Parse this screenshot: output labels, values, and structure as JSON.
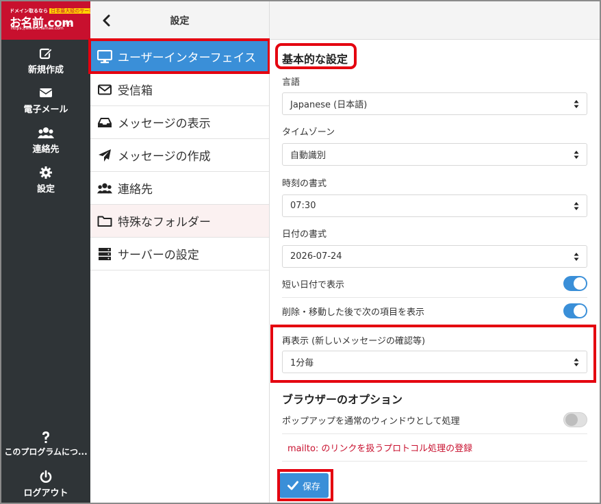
{
  "logo": {
    "tagline": "ドメイン取るなら",
    "badge": "日本最大級のサービス",
    "name": "お名前.com",
    "url": "https://www.onamae.com",
    "sub": "GMO"
  },
  "nav": {
    "items": [
      {
        "label": "新規作成",
        "icon": "compose-icon"
      },
      {
        "label": "電子メール",
        "icon": "envelope-icon"
      },
      {
        "label": "連絡先",
        "icon": "users-icon"
      },
      {
        "label": "設定",
        "icon": "gear-icon"
      }
    ],
    "about": {
      "label": "このプログラムにつ...",
      "icon": "question-icon"
    },
    "logout": {
      "label": "ログアウト",
      "icon": "power-icon"
    }
  },
  "settings": {
    "title": "設定",
    "items": [
      {
        "label": "ユーザーインターフェイス",
        "icon": "monitor-icon"
      },
      {
        "label": "受信箱",
        "icon": "envelope-outline-icon"
      },
      {
        "label": "メッセージの表示",
        "icon": "inbox-tray-icon"
      },
      {
        "label": "メッセージの作成",
        "icon": "paper-plane-icon"
      },
      {
        "label": "連絡先",
        "icon": "users-icon"
      },
      {
        "label": "特殊なフォルダー",
        "icon": "folder-icon"
      },
      {
        "label": "サーバーの設定",
        "icon": "server-icon"
      }
    ]
  },
  "main": {
    "section1_title": "基本的な設定",
    "language": {
      "label": "言語",
      "value": "Japanese (日本語)"
    },
    "timezone": {
      "label": "タイムゾーン",
      "value": "自動識別"
    },
    "time_format": {
      "label": "時刻の書式",
      "value": "07:30"
    },
    "date_format": {
      "label": "日付の書式",
      "value": "2026-07-24"
    },
    "short_date": {
      "label": "短い日付で表示",
      "enabled": true
    },
    "show_next": {
      "label": "削除・移動した後で次の項目を表示",
      "enabled": true
    },
    "refresh": {
      "label": "再表示 (新しいメッセージの確認等)",
      "value": "1分毎"
    },
    "section2_title": "ブラウザーのオプション",
    "popup": {
      "label": "ポップアップを通常のウィンドウとして処理",
      "enabled": false
    },
    "mailto_link": "mailto: のリンクを扱うプロトコル処理の登録",
    "save_label": "保存"
  },
  "colors": {
    "accent": "#3a8fd8",
    "sidebar": "#2f3437",
    "highlight": "#e4000f",
    "brand": "#c8102e"
  }
}
